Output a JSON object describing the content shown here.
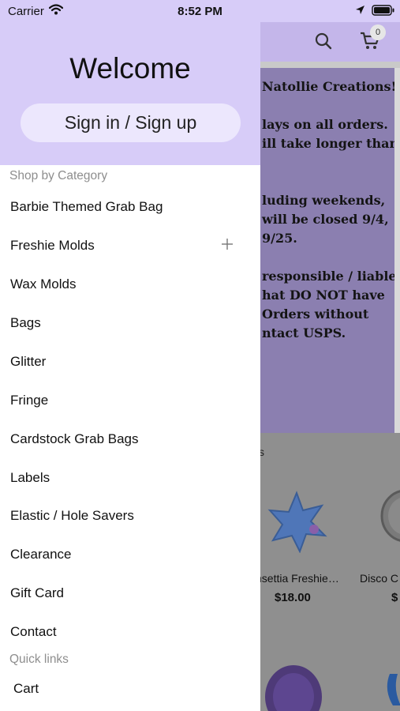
{
  "status_bar": {
    "carrier": "Carrier",
    "time": "8:52 PM"
  },
  "background": {
    "cart_count": "0",
    "banner_lines": [
      "Natollie Creations!",
      "",
      "lays on all orders.",
      "ill take longer than",
      "",
      "",
      "luding weekends,",
      "will be closed 9/4,",
      "9/25.",
      "",
      "responsible / liable",
      "hat DO NOT have",
      "Orders without",
      "ntact USPS."
    ],
    "section_label": "s",
    "products": [
      {
        "name": "nsettia Freshie…",
        "price": "$18.00"
      },
      {
        "name": "Disco C",
        "price": "$"
      }
    ]
  },
  "drawer": {
    "welcome": "Welcome",
    "signin_label": "Sign in / Sign up",
    "shop_by_category": "Shop by Category",
    "categories": [
      "Barbie Themed Grab Bag",
      "Freshie Molds",
      "Wax Molds",
      "Bags",
      "Glitter",
      "Fringe",
      "Cardstock Grab Bags",
      "Labels",
      "Elastic / Hole Savers",
      "Clearance",
      "Gift Card",
      "Contact"
    ],
    "quick_links_title": "Quick links",
    "quick_links": [
      "Cart"
    ]
  },
  "colors": {
    "accent": "#d7ccf8",
    "banner": "#8b7fb0",
    "signin_button": "#ece7fd"
  }
}
